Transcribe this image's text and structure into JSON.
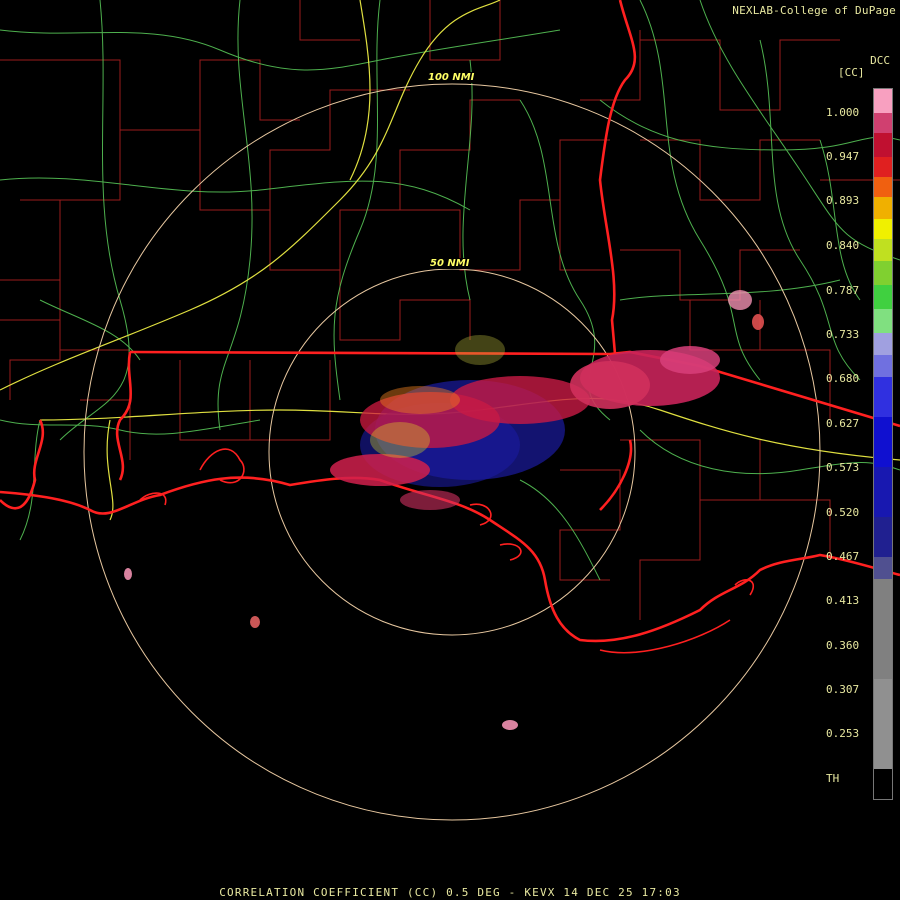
{
  "header": {
    "credit": "NEXLAB-College of DuPage",
    "station_code": "DCC",
    "unit_label": "[CC]"
  },
  "map": {
    "ring_labels": [
      "100 NMI",
      "50 NMI"
    ],
    "colors": {
      "state_border": "#ff2020",
      "county_border": "#a02020",
      "highway_primary": "#e0e040",
      "highway_secondary": "#60d060",
      "range_ring": "#e8c8a0"
    }
  },
  "legend": {
    "ticks": [
      "1.000",
      "0.947",
      "0.893",
      "0.840",
      "0.787",
      "0.733",
      "0.680",
      "0.627",
      "0.573",
      "0.520",
      "0.467",
      "0.413",
      "0.360",
      "0.307",
      "0.253",
      "TH"
    ]
  },
  "footer": {
    "caption": "CORRELATION COEFFICIENT (CC) 0.5 DEG - KEVX 14 DEC 25 17:03"
  }
}
